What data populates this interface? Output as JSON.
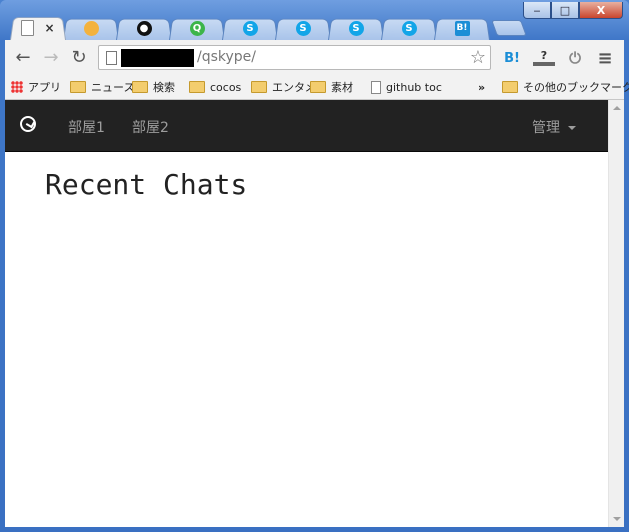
{
  "browser": {
    "tabs": [
      {
        "icon": "blank-page-icon",
        "active": true,
        "close": "×"
      },
      {
        "icon": "orange-site-icon",
        "glyph": ""
      },
      {
        "icon": "github-icon",
        "glyph": "●"
      },
      {
        "icon": "q-green-icon",
        "glyph": "Q"
      },
      {
        "icon": "skype-icon",
        "glyph": "S"
      },
      {
        "icon": "skype-icon",
        "glyph": "S"
      },
      {
        "icon": "skype-icon",
        "glyph": "S"
      },
      {
        "icon": "skype-icon",
        "glyph": "S"
      },
      {
        "icon": "hatena-bookmark-icon",
        "glyph": "B!"
      }
    ],
    "window_controls": {
      "minimize": "‒",
      "maximize": "□",
      "close": "X"
    },
    "address": {
      "path": "/qskype/"
    },
    "toolbar_icons": {
      "hatena": "B!",
      "extension": "?",
      "power": "⏻",
      "menu": "≡"
    },
    "bookmarks": [
      {
        "type": "apps",
        "label": "アプリ"
      },
      {
        "type": "folder",
        "label": "ニュース"
      },
      {
        "type": "folder",
        "label": "検索"
      },
      {
        "type": "folder",
        "label": "cocos"
      },
      {
        "type": "folder",
        "label": "エンタメ"
      },
      {
        "type": "folder",
        "label": "素材"
      },
      {
        "type": "page",
        "label": "github toc"
      }
    ],
    "bookmarks_overflow": "»",
    "other_bookmarks": "その他のブックマーク"
  },
  "site": {
    "nav": {
      "links": [
        "部屋1",
        "部屋2"
      ],
      "admin_menu": "管理"
    },
    "page_title": "Recent Chats"
  },
  "colors": {
    "navbar_bg": "#222222",
    "navbar_text": "#9d9d9d",
    "window_frame": "#3f77c8"
  }
}
